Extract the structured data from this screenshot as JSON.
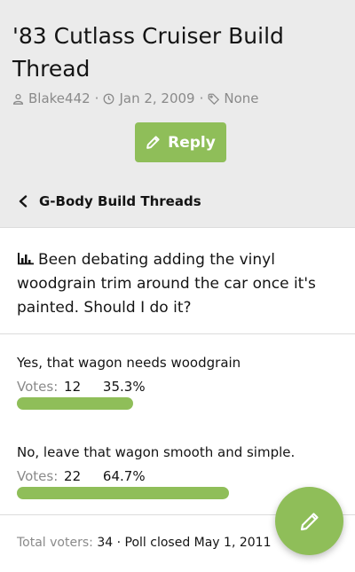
{
  "thread": {
    "title": "'83 Cutlass Cruiser Build Thread",
    "author": "Blake442",
    "date": "Jan 2, 2009",
    "tags": "None",
    "author_icon": "user-icon",
    "date_icon": "clock-icon",
    "tags_icon": "tag-icon"
  },
  "actions": {
    "reply_label": "Reply",
    "reply_icon": "pencil-icon",
    "fab_icon": "pencil-icon"
  },
  "breadcrumb": {
    "label": "G-Body Build Threads",
    "icon": "chevron-left-icon"
  },
  "poll": {
    "icon": "bar-chart-icon",
    "question": "Been debating adding the vinyl woodgrain trim around the car once it's painted. Should I do it?",
    "votes_label": "Votes:",
    "options": [
      {
        "label": "Yes, that wagon needs woodgrain",
        "votes": "12",
        "percent": "35.3%",
        "fraction": 0.353
      },
      {
        "label": "No, leave that wagon smooth and simple.",
        "votes": "22",
        "percent": "64.7%",
        "fraction": 0.647
      }
    ],
    "total_label": "Total voters:",
    "total_voters": "34",
    "closed_text": "Poll closed May 1, 2011"
  },
  "colors": {
    "accent": "#8fbe59",
    "header_bg": "#ebebeb",
    "muted_text": "#8a8a8a"
  }
}
